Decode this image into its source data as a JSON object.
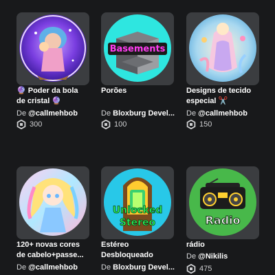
{
  "items": [
    {
      "title_line1": "🔮 Poder da bola",
      "title_line2": "de cristal 🔮",
      "creator_prefix": "De",
      "creator": "@callmehbob",
      "price": "300",
      "icon": "crystal-ball-girl-art"
    },
    {
      "title_line1": "Porões",
      "title_line2": "",
      "creator_prefix": "De",
      "creator": "Bloxburg Devel...",
      "price": "100",
      "icon": "basements-room-art",
      "art_text": "Basements"
    },
    {
      "title_line1": "Designs de tecido",
      "title_line2": "especial ✂️",
      "creator_prefix": "De",
      "creator": "@callmehbob",
      "price": "150",
      "icon": "fabric-design-art"
    },
    {
      "title_line1": "120+ novas cores",
      "title_line2": "de cabelo+passe...",
      "creator_prefix": "De",
      "creator": "@callmehbob",
      "price": "",
      "icon": "hair-colors-girl-art"
    },
    {
      "title_line1": "Estéreo",
      "title_line2": "Desbloqueado",
      "creator_prefix": "De",
      "creator": "Bloxburg Devel...",
      "price": "",
      "icon": "jukebox-art",
      "art_text_1": "Unlocked",
      "art_text_2": "Stereo"
    },
    {
      "title_line1": "rádio",
      "title_line2": "",
      "creator_prefix": "De",
      "creator": "@Nikilis",
      "price": "475",
      "icon": "boombox-radio-art",
      "art_text": "Radio"
    }
  ],
  "colors": {
    "background": "#18191b",
    "card_bg": "#3b3d40",
    "text_secondary": "#d6d7d9"
  }
}
